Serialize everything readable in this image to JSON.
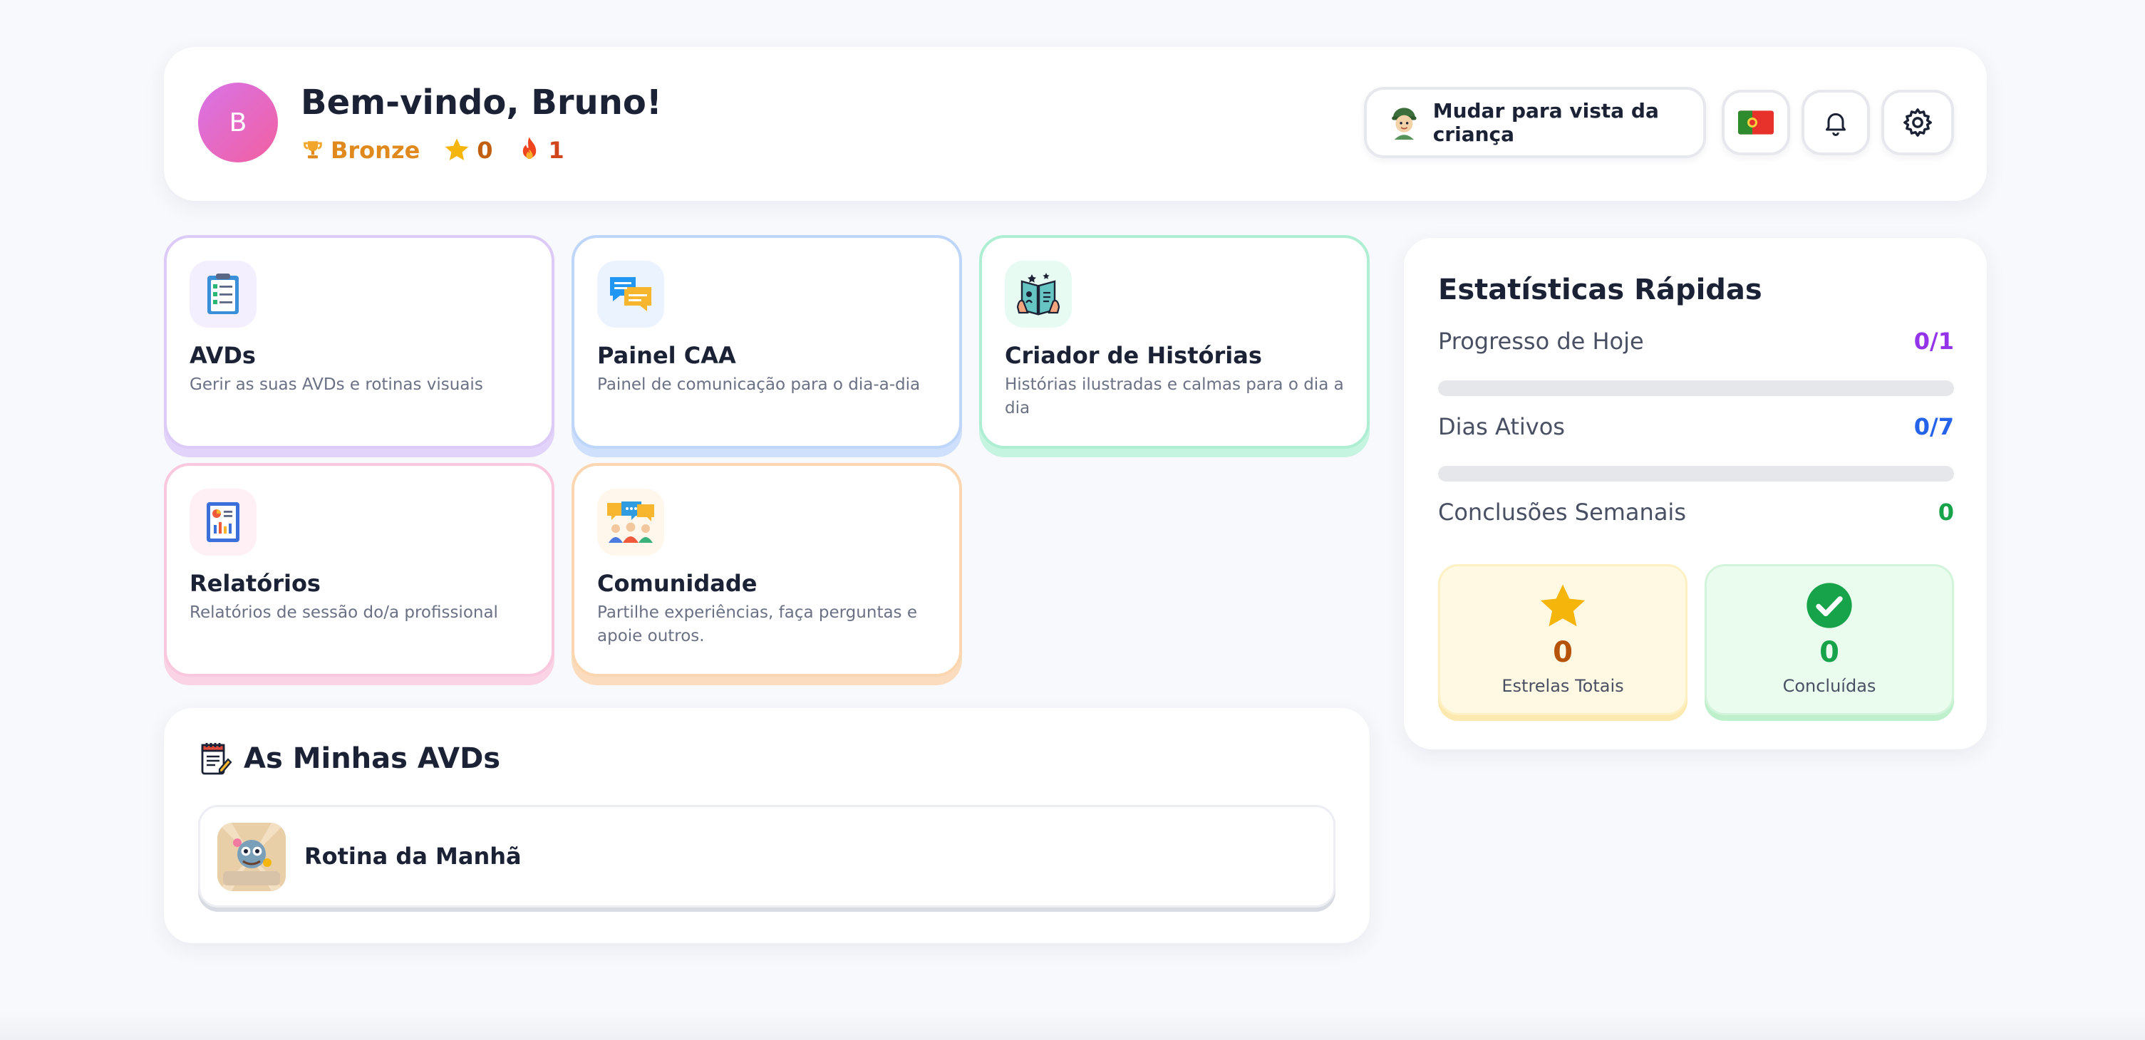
{
  "header": {
    "avatar_initial": "B",
    "welcome": "Bem-vindo, Bruno!",
    "level": "Bronze",
    "stars": "0",
    "streak": "1",
    "child_view_button": "Mudar para vista da criança",
    "language_flag": "pt-flag-icon",
    "notifications_icon": "bell-icon",
    "settings_icon": "gear-icon"
  },
  "features": [
    {
      "title": "AVDs",
      "description": "Gerir as suas AVDs e rotinas visuais",
      "icon": "checklist-icon",
      "accent": "#dccaf7"
    },
    {
      "title": "Painel CAA",
      "description": "Painel de comunicação para o dia-a-dia",
      "icon": "chat-bubbles-icon",
      "accent": "#bfd6fb"
    },
    {
      "title": "Criador de Histórias",
      "description": "Histórias ilustradas e calmas para o dia a dia",
      "icon": "open-book-icon",
      "accent": "#aeefd3"
    },
    {
      "title": "Relatórios",
      "description": "Relatórios de sessão do/a profissional",
      "icon": "report-icon",
      "accent": "#f9c8de"
    },
    {
      "title": "Comunidade",
      "description": "Partilhe experiências, faça perguntas e apoie outros.",
      "icon": "community-icon",
      "accent": "#fbd6b0"
    }
  ],
  "my_avds": {
    "title": "As Minhas AVDs",
    "icon": "notepad-icon",
    "items": [
      {
        "name": "Rotina da Manhã",
        "icon": "morning-routine-thumbnail"
      }
    ]
  },
  "stats": {
    "title": "Estatísticas Rápidas",
    "today_label": "Progresso de Hoje",
    "today_value": "0/1",
    "today_progress": 0,
    "today_color": "#9333ea",
    "active_label": "Dias Ativos",
    "active_value": "0/7",
    "active_progress": 0,
    "active_color": "#2563eb",
    "weekly_label": "Conclusões Semanais",
    "weekly_value": "0",
    "weekly_color": "#16a34a",
    "total_stars_value": "0",
    "total_stars_label": "Estrelas Totais",
    "completed_value": "0",
    "completed_label": "Concluídas"
  }
}
